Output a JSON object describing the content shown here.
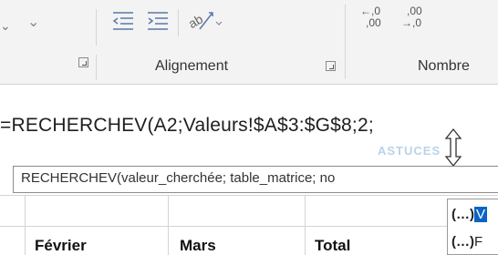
{
  "ribbon": {
    "groups": [
      {
        "label": "Alignement"
      },
      {
        "label": "Nombre"
      }
    ],
    "icons": {
      "decrease_indent": "decrease-indent-icon",
      "increase_indent": "increase-indent-icon",
      "orientation": "text-orientation-icon",
      "add_decimal": "increase-decimal-icon",
      "remove_decimal": "decrease-decimal-icon"
    },
    "decimal_top_left": "←,0",
    "decimal_bottom_left": ",00",
    "decimal_top_right": ",00",
    "decimal_bottom_right": "→,0"
  },
  "formula_bar": {
    "text": "=RECHERCHEV(A2;Valeurs!$A$3:$G$8;2;"
  },
  "tooltip": {
    "text": "RECHERCHEV(valeur_cherchée; table_matrice; no"
  },
  "grid": {
    "headers": [
      "Février",
      "Mars",
      "Total"
    ]
  },
  "autocomplete": {
    "items": [
      {
        "prefix": "(…)",
        "label": "V"
      },
      {
        "prefix": "(…)",
        "label": "F"
      }
    ]
  },
  "watermark": "ASTUCES"
}
